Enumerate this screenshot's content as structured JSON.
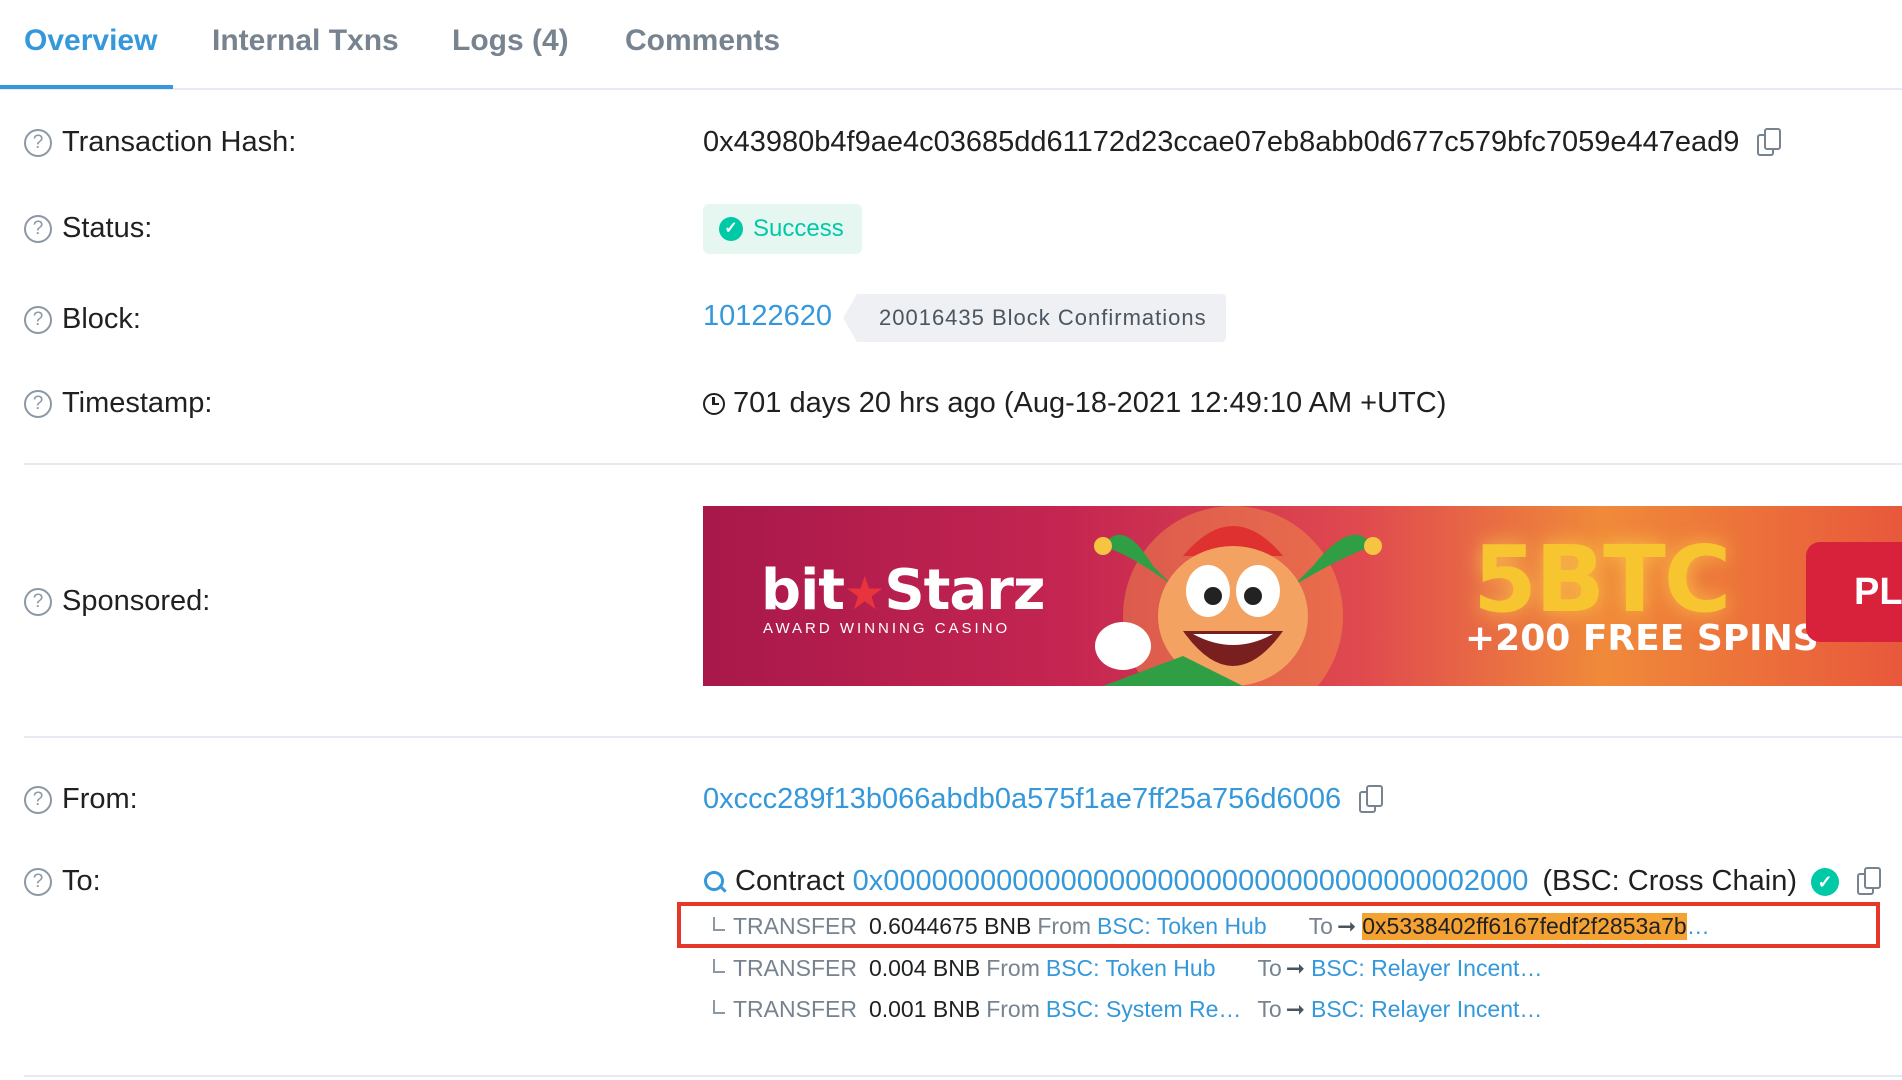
{
  "tabs": [
    {
      "label": "Overview",
      "active": true
    },
    {
      "label": "Internal Txns"
    },
    {
      "label": "Logs (4)"
    },
    {
      "label": "Comments"
    }
  ],
  "rows": {
    "tx_hash": {
      "label": "Transaction Hash:",
      "value": "0x43980b4f9ae4c03685dd61172d23ccae07eb8abb0d677c579bfc7059e447ead9"
    },
    "status": {
      "label": "Status:",
      "value": "Success"
    },
    "block": {
      "label": "Block:",
      "value": "10122620",
      "confirmations": "20016435 Block Confirmations"
    },
    "timestamp": {
      "label": "Timestamp:",
      "value": "701 days 20 hrs ago (Aug-18-2021 12:49:10 AM +UTC)"
    },
    "sponsored": {
      "label": "Sponsored:"
    },
    "from": {
      "label": "From:",
      "value": "0xccc289f13b066abdb0a575f1ae7ff25a756d6006"
    },
    "to": {
      "label": "To:",
      "prefix": "Contract",
      "address": "0x0000000000000000000000000000000000002000",
      "name": "(BSC: Cross Chain)"
    }
  },
  "ad": {
    "brand_left": "bit",
    "brand_right": "Starz",
    "tagline": "AWARD WINNING CASINO",
    "headline": "5BTC",
    "subline": "+200 FREE SPINS",
    "button": "PL"
  },
  "transfers": [
    {
      "word": "TRANSFER",
      "amount": "0.6044675 BNB",
      "from_word": "From",
      "from": "BSC: Token Hub",
      "to_word": "To",
      "to": "0x5338402ff6167fedf2f2853a7b",
      "ellipsis": "…"
    },
    {
      "word": "TRANSFER",
      "amount": "0.004 BNB",
      "from_word": "From",
      "from": "BSC: Token Hub",
      "to_word": "To",
      "to": "BSC: Relayer Incent…"
    },
    {
      "word": "TRANSFER",
      "amount": "0.001 BNB",
      "from_word": "From",
      "from": "BSC: System Re…",
      "to_word": "To",
      "to": "BSC: Relayer Incent…"
    }
  ],
  "colors": {
    "accent": "#3498db",
    "success": "#00c9a7",
    "highlight": "#f4a233",
    "annotation_box": "#e5382a"
  }
}
